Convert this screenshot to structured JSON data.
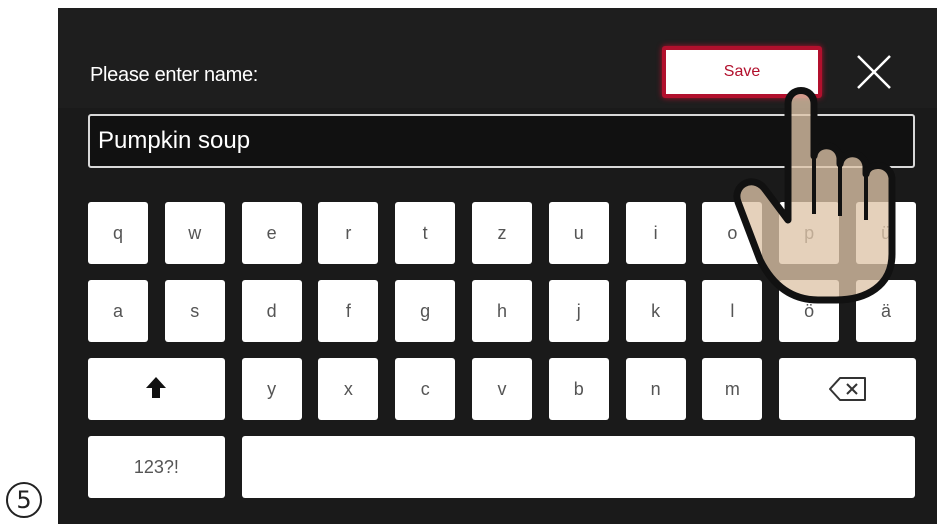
{
  "step_label": "5",
  "dialog": {
    "prompt": "Please enter name:",
    "save_label": "Save",
    "input_value": "Pumpkin soup"
  },
  "keyboard": {
    "row1": [
      "q",
      "w",
      "e",
      "r",
      "t",
      "z",
      "u",
      "i",
      "o",
      "p",
      "ü"
    ],
    "row2": [
      "a",
      "s",
      "d",
      "f",
      "g",
      "h",
      "j",
      "k",
      "l",
      "ö",
      "ä"
    ],
    "row3": [
      "y",
      "x",
      "c",
      "v",
      "b",
      "n",
      "m"
    ],
    "numbers_label": "123?!"
  },
  "icons": {
    "close": "close-icon",
    "shift": "shift-arrow-icon",
    "backspace": "backspace-icon",
    "pointer": "pointing-hand-icon"
  },
  "colors": {
    "accent": "#b2102d",
    "panel": "#1a1a1a",
    "key": "#ffffff"
  }
}
